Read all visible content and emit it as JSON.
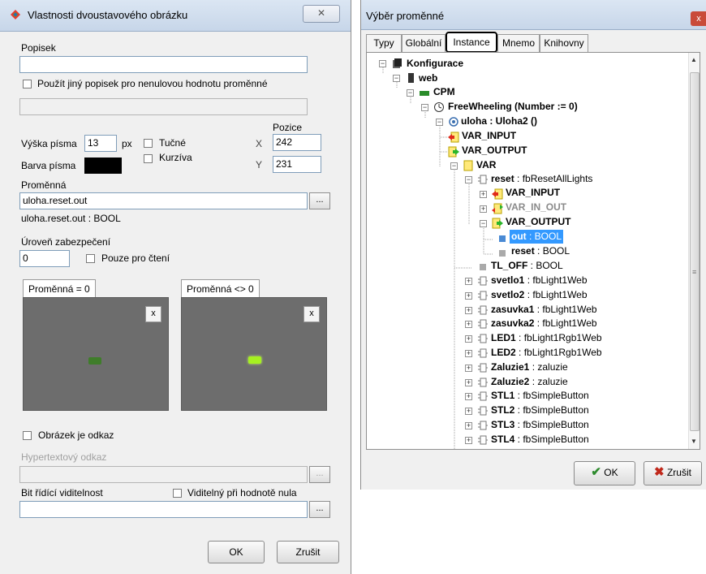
{
  "left_dialog": {
    "title": "Vlastnosti dvoustavového obrázku",
    "close_label": "ℤ",
    "popisek_label": "Popisek",
    "popisek_value": "",
    "alt_label_checkbox": "Použít jiný popisek pro nenulovou hodnotu proměnné",
    "font_height_label": "Výška písma",
    "font_height_value": "13",
    "font_height_unit": "px",
    "bold_label": "Tučné",
    "italic_label": "Kurzíva",
    "font_color_label": "Barva písma",
    "font_color": "#000000",
    "position_label": "Pozice",
    "x_label": "X",
    "x_value": "242",
    "y_label": "Y",
    "y_value": "231",
    "variable_label": "Proměnná",
    "variable_value": "uloha.reset.out",
    "variable_type": "uloha.reset.out : BOOL",
    "dots": "...",
    "security_label": "Úroveň zabezpečení",
    "security_value": "0",
    "readonly_label": "Pouze pro čtení",
    "tab_zero": "Proměnná = 0",
    "tab_nonzero": "Proměnná <> 0",
    "x_button": "x",
    "image_link_label": "Obrázek je odkaz",
    "hyperlink_label": "Hypertextový odkaz",
    "visibility_bit_label": "Bit řídící viditelnost",
    "visible_zero_label": "Viditelný při hodnotě nula",
    "ok_label": "OK",
    "cancel_label": "Zrušit",
    "colors": {
      "lamp_off": "#3f7d2a",
      "lamp_on": "#a6f020",
      "panel_bg": "#6d6d6d"
    }
  },
  "right_dialog": {
    "title": "Výběr proměnné",
    "close_label": "x",
    "tabs": [
      "Typy",
      "Globální",
      "Instance",
      "Mnemo",
      "Knihovny"
    ],
    "active_tab": "Instance",
    "tree": [
      {
        "name": "Konfigurace",
        "detail": ""
      },
      {
        "name": "web",
        "detail": ""
      },
      {
        "name": "CPM",
        "detail": ""
      },
      {
        "name": "FreeWheeling (Number := 0)",
        "detail": ""
      },
      {
        "name": "uloha : Uloha2 ()",
        "detail": ""
      },
      {
        "name": "VAR_INPUT",
        "detail": ""
      },
      {
        "name": "VAR_OUTPUT",
        "detail": ""
      },
      {
        "name": "VAR",
        "detail": ""
      },
      {
        "name": "reset",
        "detail": " : fbResetAllLights"
      },
      {
        "name": "VAR_INPUT",
        "detail": ""
      },
      {
        "name": "VAR_IN_OUT",
        "detail": ""
      },
      {
        "name": "VAR_OUTPUT",
        "detail": ""
      },
      {
        "name": "out",
        "detail": " : BOOL"
      },
      {
        "name": "reset",
        "detail": " : BOOL"
      },
      {
        "name": "TL_OFF",
        "detail": " : BOOL"
      },
      {
        "name": "svetlo1",
        "detail": " : fbLight1Web"
      },
      {
        "name": "svetlo2",
        "detail": " : fbLight1Web"
      },
      {
        "name": "zasuvka1",
        "detail": " : fbLight1Web"
      },
      {
        "name": "zasuvka2",
        "detail": " : fbLight1Web"
      },
      {
        "name": "LED1",
        "detail": " : fbLight1Rgb1Web"
      },
      {
        "name": "LED2",
        "detail": " : fbLight1Rgb1Web"
      },
      {
        "name": "Zaluzie1",
        "detail": " : zaluzie"
      },
      {
        "name": "Zaluzie2",
        "detail": " : zaluzie"
      },
      {
        "name": "STL1",
        "detail": " : fbSimpleButton"
      },
      {
        "name": "STL2",
        "detail": " : fbSimpleButton"
      },
      {
        "name": "STL3",
        "detail": " : fbSimpleButton"
      },
      {
        "name": "STL4",
        "detail": " : fbSimpleButton"
      }
    ],
    "ok_label": "OK",
    "cancel_label": "Zrušit",
    "colors": {
      "selection": "#3399ff",
      "ok_check": "#2e8b2e",
      "cancel_x": "#c0281b"
    }
  }
}
